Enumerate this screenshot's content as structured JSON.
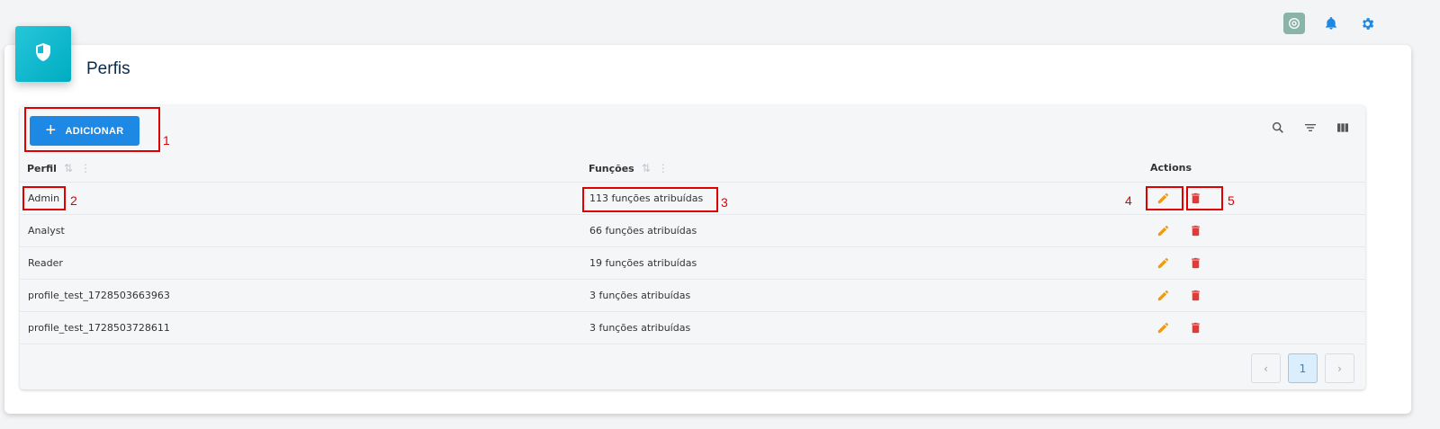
{
  "header": {
    "icons": [
      "chatgpt-icon",
      "bell-icon",
      "gear-icon"
    ],
    "accent_color": "#1e88e5"
  },
  "page": {
    "title": "Perfis",
    "badge_icon": "shield-icon"
  },
  "toolbar": {
    "add_label": "ADICIONAR",
    "right_icons": [
      "search-icon",
      "filter-icon",
      "columns-icon"
    ]
  },
  "table": {
    "columns": [
      "Perfil",
      "Funções",
      "Actions"
    ],
    "rows": [
      {
        "perfil": "Admin",
        "funcoes": "113 funções atribuídas"
      },
      {
        "perfil": "Analyst",
        "funcoes": "66 funções atribuídas"
      },
      {
        "perfil": "Reader",
        "funcoes": "19 funções atribuídas"
      },
      {
        "perfil": "profile_test_1728503663963",
        "funcoes": "3 funções atribuídas"
      },
      {
        "perfil": "profile_test_1728503728611",
        "funcoes": "3 funções atribuídas"
      }
    ],
    "edit_color": "#f29a0e",
    "delete_color": "#e53935"
  },
  "pagination": {
    "prev": "‹",
    "current": "1",
    "next": "›"
  },
  "annotations": [
    "1",
    "2",
    "3",
    "4",
    "5"
  ]
}
